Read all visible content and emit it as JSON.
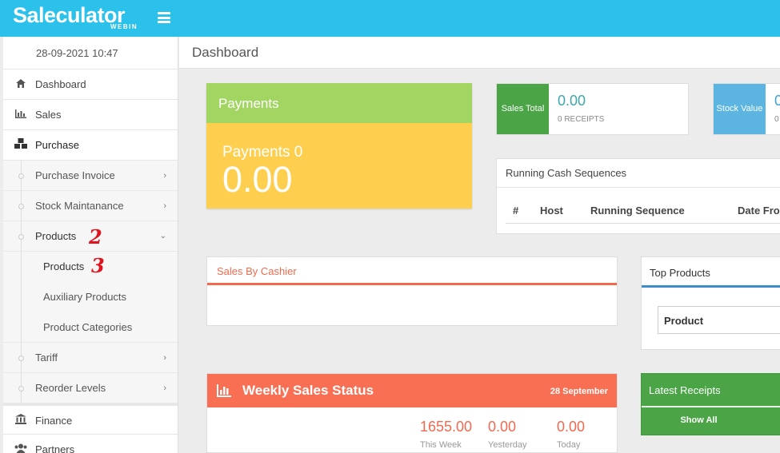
{
  "brand": {
    "name": "Saleculator",
    "sub": "WEBIN"
  },
  "sidebar": {
    "datetime": "28-09-2021 10:47",
    "items": [
      {
        "label": "Dashboard",
        "icon": "home-icon"
      },
      {
        "label": "Sales",
        "icon": "bar-chart-icon"
      },
      {
        "label": "Purchase",
        "icon": "cubes-icon"
      }
    ],
    "purchase_sub": [
      {
        "label": "Purchase Invoice"
      },
      {
        "label": "Stock Maintanance"
      },
      {
        "label": "Products"
      }
    ],
    "products_sub": [
      {
        "label": "Products"
      },
      {
        "label": "Auxiliary Products"
      },
      {
        "label": "Product Categories"
      }
    ],
    "purchase_sub_more": [
      {
        "label": "Tariff"
      },
      {
        "label": "Reorder Levels"
      }
    ],
    "bottom_items": [
      {
        "label": "Finance",
        "icon": "bank-icon"
      },
      {
        "label": "Partners",
        "icon": "users-icon"
      }
    ],
    "annotations": [
      "2",
      "3"
    ]
  },
  "page": {
    "title": "Dashboard"
  },
  "payments": {
    "title": "Payments",
    "label": "Payments 0",
    "value": "0.00"
  },
  "sales_total": {
    "tag": "Sales Total",
    "value": "0.00",
    "sub": "0 RECEIPTS",
    "color": "#4ba547"
  },
  "stock_value": {
    "tag": "Stock Value",
    "value": "0",
    "sub": "0",
    "color": "#5bb5e0"
  },
  "running_cash": {
    "title": "Running Cash Sequences",
    "columns": [
      "#",
      "Host",
      "Running Sequence",
      "Date Fro"
    ]
  },
  "sales_by_cashier": {
    "title": "Sales By Cashier"
  },
  "top_products": {
    "title": "Top Products",
    "field": "Product"
  },
  "weekly": {
    "title": "Weekly Sales Status",
    "date": "28 September",
    "stats": [
      {
        "value": "1655.00",
        "label": "This Week"
      },
      {
        "value": "0.00",
        "label": "Yesterday"
      },
      {
        "value": "0.00",
        "label": "Today"
      }
    ]
  },
  "latest_receipts": {
    "title": "Latest Receipts",
    "button": "Show All"
  }
}
